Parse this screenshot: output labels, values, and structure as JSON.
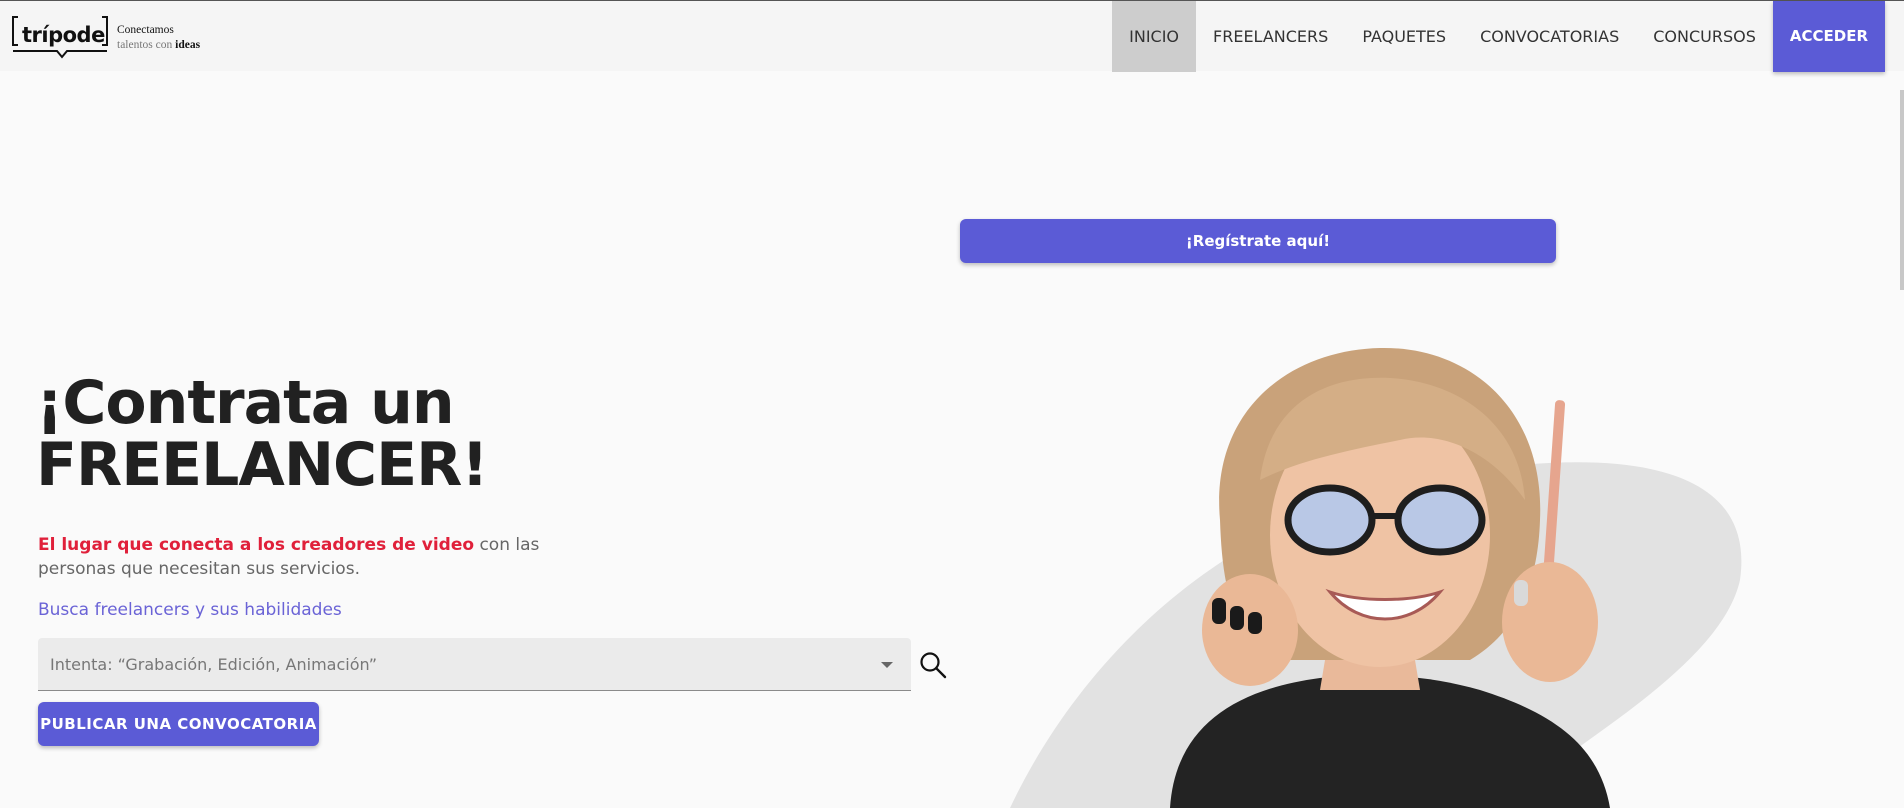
{
  "header": {
    "logo_text": "trípode",
    "tagline_line1": "Conectamos",
    "tagline_line2_prefix": "talentos con ",
    "tagline_line2_bold": "ideas",
    "nav": [
      {
        "label": "INICIO"
      },
      {
        "label": "FREELANCERS"
      },
      {
        "label": "PAQUETES"
      },
      {
        "label": "CONVOCATORIAS"
      },
      {
        "label": "CONCURSOS"
      },
      {
        "label": "ACCEDER"
      }
    ]
  },
  "register": {
    "label": "¡Regístrate aquí!"
  },
  "hero": {
    "title_line1": "¡Contrata un",
    "title_line2": "FREELANCER!",
    "desc_highlight": "El lugar que conecta a los creadores de video",
    "desc_rest": " con las personas que necesitan sus servicios.",
    "search_label": "Busca freelancers y sus habilidades",
    "search_placeholder": "Intenta: “Grabación, Edición, Animación”",
    "publish_label": "PUBLICAR UNA CONVOCATORIA"
  },
  "icons": {
    "search": "search-icon",
    "dropdown": "chevron-down-icon"
  },
  "colors": {
    "accent": "#5b5bd6",
    "highlight": "#e0203a",
    "link": "#6a63d6",
    "nav_active_bg": "#cdcdcd"
  }
}
